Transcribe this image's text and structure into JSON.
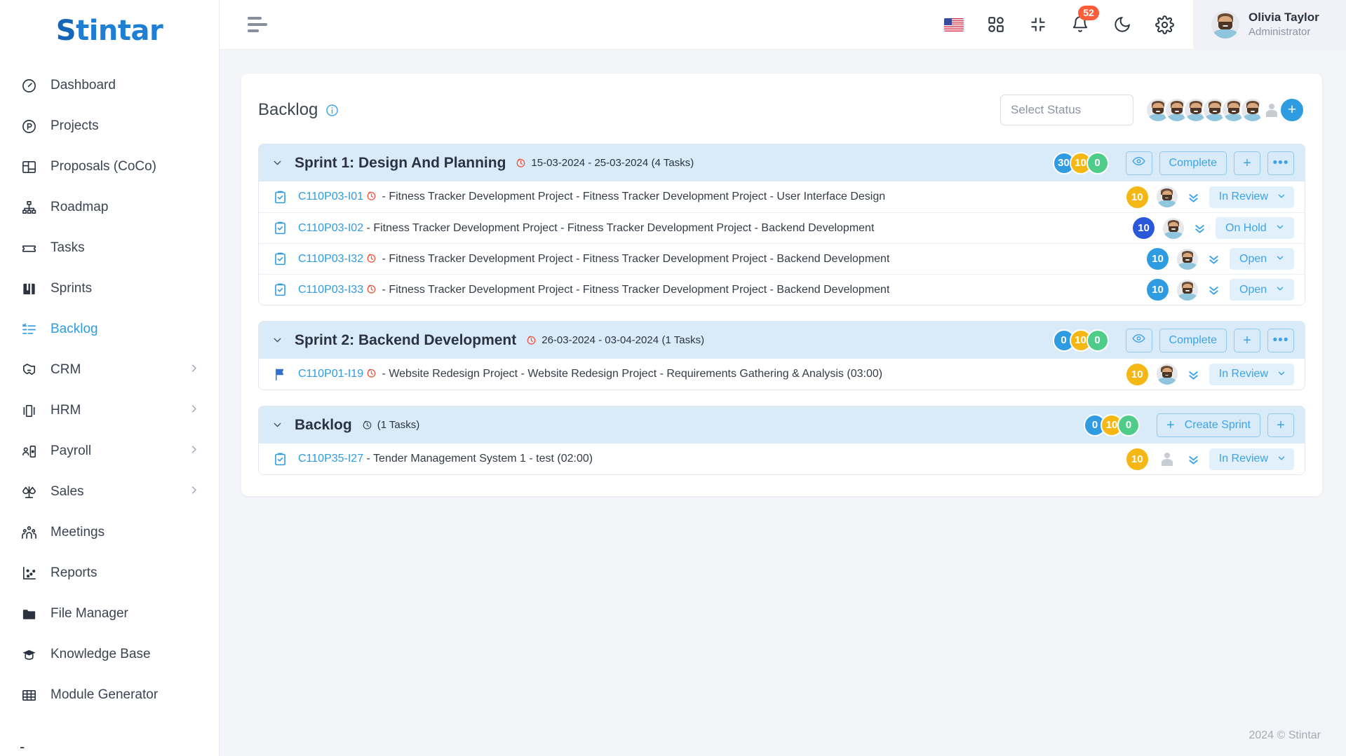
{
  "brand": {
    "name": "Stintar",
    "first_letter": "S",
    "rest": "tintar"
  },
  "sidebar": {
    "items": [
      {
        "label": "Dashboard",
        "icon": "gauge-icon",
        "has_chevron": false,
        "active": false
      },
      {
        "label": "Projects",
        "icon": "circle-p-icon",
        "has_chevron": false,
        "active": false
      },
      {
        "label": "Proposals (CoCo)",
        "icon": "layout-icon",
        "has_chevron": false,
        "active": false
      },
      {
        "label": "Roadmap",
        "icon": "hierarchy-icon",
        "has_chevron": false,
        "active": false
      },
      {
        "label": "Tasks",
        "icon": "ticket-icon",
        "has_chevron": false,
        "active": false
      },
      {
        "label": "Sprints",
        "icon": "board-icon",
        "has_chevron": false,
        "active": false
      },
      {
        "label": "Backlog",
        "icon": "checklist-icon",
        "has_chevron": false,
        "active": true
      },
      {
        "label": "CRM",
        "icon": "handshake-icon",
        "has_chevron": true,
        "active": false
      },
      {
        "label": "HRM",
        "icon": "id-card-icon",
        "has_chevron": true,
        "active": false
      },
      {
        "label": "Payroll",
        "icon": "person-card-icon",
        "has_chevron": true,
        "active": false
      },
      {
        "label": "Sales",
        "icon": "scale-icon",
        "has_chevron": true,
        "active": false
      },
      {
        "label": "Meetings",
        "icon": "people-icon",
        "has_chevron": false,
        "active": false
      },
      {
        "label": "Reports",
        "icon": "scatter-chart-icon",
        "has_chevron": false,
        "active": false
      },
      {
        "label": "File Manager",
        "icon": "folder-icon",
        "has_chevron": false,
        "active": false
      },
      {
        "label": "Knowledge Base",
        "icon": "graduation-cap-icon",
        "has_chevron": false,
        "active": false
      },
      {
        "label": "Module Generator",
        "icon": "grid-table-icon",
        "has_chevron": false,
        "active": false
      }
    ],
    "trailing_dot": "-"
  },
  "topbar": {
    "menu_icon": "hamburger-icon",
    "language_flag": "us-flag-icon",
    "apps_icon": "grid-apps-icon",
    "fullscreen_icon": "compress-icon",
    "notification_icon": "bell-icon",
    "notification_count": "52",
    "theme_icon": "moon-icon",
    "settings_icon": "gear-icon",
    "user": {
      "name": "Olivia Taylor",
      "role": "Administrator"
    }
  },
  "page": {
    "title": "Backlog",
    "info_icon": "info-circle-icon",
    "status_filter_placeholder": "Select Status",
    "member_avatar_count": 6,
    "add_member_label": "+"
  },
  "groups": [
    {
      "title": "Sprint 1: Design And Planning",
      "clock_icon": "clock-icon",
      "clock_color": "red",
      "dates": "15-03-2024 - 25-03-2024",
      "task_count_label": "(4 Tasks)",
      "pills": [
        {
          "value": "30",
          "color": "blue"
        },
        {
          "value": "10",
          "color": "amber"
        },
        {
          "value": "0",
          "color": "green"
        }
      ],
      "buttons": [
        {
          "label": "",
          "icon": "eye-icon",
          "name": "watch-sprint-button"
        },
        {
          "label": "Complete",
          "icon": "",
          "name": "complete-sprint-button"
        },
        {
          "label": "",
          "icon": "plus-icon",
          "name": "add-task-button"
        },
        {
          "label": "",
          "icon": "ellipsis-icon",
          "name": "sprint-more-button"
        }
      ],
      "tasks": [
        {
          "icon": "clipboard-check-icon",
          "key": "C110P03-I01",
          "has_clock": true,
          "text": " - Fitness Tracker Development Project - Fitness Tracker Development Project - User Interface Design",
          "hours": "10",
          "hours_color": "amber",
          "avatar": "photo",
          "status": "In Review",
          "status_width": "w-inreview"
        },
        {
          "icon": "clipboard-check-icon",
          "key": "C110P03-I02",
          "has_clock": false,
          "text": " - Fitness Tracker Development Project - Fitness Tracker Development Project - Backend Development",
          "hours": "10",
          "hours_color": "navy",
          "avatar": "photo",
          "status": "On Hold",
          "status_width": "w-onhold"
        },
        {
          "icon": "clipboard-check-icon",
          "key": "C110P03-I32",
          "has_clock": true,
          "text": " - Fitness Tracker Development Project - Fitness Tracker Development Project - Backend Development",
          "hours": "10",
          "hours_color": "blue",
          "avatar": "photo",
          "status": "Open",
          "status_width": "w-open"
        },
        {
          "icon": "clipboard-check-icon",
          "key": "C110P03-I33",
          "has_clock": true,
          "text": " - Fitness Tracker Development Project - Fitness Tracker Development Project - Backend Development",
          "hours": "10",
          "hours_color": "blue",
          "avatar": "photo",
          "status": "Open",
          "status_width": "w-open"
        }
      ]
    },
    {
      "title": "Sprint 2: Backend Development",
      "clock_icon": "clock-icon",
      "clock_color": "red",
      "dates": "26-03-2024 - 03-04-2024",
      "task_count_label": "(1 Tasks)",
      "pills": [
        {
          "value": "0",
          "color": "blue"
        },
        {
          "value": "10",
          "color": "amber"
        },
        {
          "value": "0",
          "color": "green"
        }
      ],
      "buttons": [
        {
          "label": "",
          "icon": "eye-icon",
          "name": "watch-sprint-button"
        },
        {
          "label": "Complete",
          "icon": "",
          "name": "complete-sprint-button"
        },
        {
          "label": "",
          "icon": "plus-icon",
          "name": "add-task-button"
        },
        {
          "label": "",
          "icon": "ellipsis-icon",
          "name": "sprint-more-button"
        }
      ],
      "tasks": [
        {
          "icon": "flag-icon",
          "key": "C110P01-I19",
          "has_clock": true,
          "text": " - Website Redesign Project - Website Redesign Project - Requirements Gathering & Analysis (03:00)",
          "hours": "10",
          "hours_color": "amber",
          "avatar": "photo",
          "status": "In Review",
          "status_width": "w-inreview"
        }
      ]
    },
    {
      "title": "Backlog",
      "clock_icon": "clock-icon",
      "clock_color": "gray",
      "dates": "",
      "task_count_label": "(1 Tasks)",
      "pills": [
        {
          "value": "0",
          "color": "blue"
        },
        {
          "value": "10",
          "color": "amber"
        },
        {
          "value": "0",
          "color": "green"
        }
      ],
      "buttons": [
        {
          "label": "Create Sprint",
          "icon": "plus-icon",
          "name": "create-sprint-button"
        },
        {
          "label": "",
          "icon": "plus-icon",
          "name": "add-backlog-task-button"
        }
      ],
      "tasks": [
        {
          "icon": "clipboard-check-icon",
          "key": "C110P35-I27",
          "has_clock": false,
          "text": " - Tender Management System 1 - test (02:00)",
          "hours": "10",
          "hours_color": "amber",
          "avatar": "blank",
          "status": "In Review",
          "status_width": "w-inreview"
        }
      ]
    }
  ],
  "footer": {
    "copyright": "2024 © Stintar"
  },
  "colors": {
    "accent": "#2f9be0",
    "sprint_header_bg": "#d9ebf9",
    "amber": "#f5b714",
    "green": "#4fcb8a",
    "navy": "#2b58d9",
    "red": "#f0503a",
    "notification": "#ff5c39"
  }
}
